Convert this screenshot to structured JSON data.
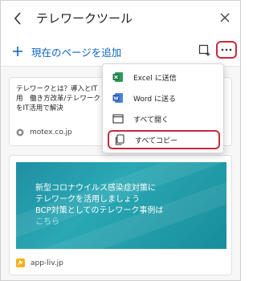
{
  "header": {
    "title": "テレワークツール"
  },
  "toolbar": {
    "add_page_label": "現在のページを追加"
  },
  "menu": {
    "items": [
      {
        "label": "Excel に送信",
        "icon": "excel-icon"
      },
      {
        "label": "Word に送る",
        "icon": "word-icon"
      },
      {
        "label": "すべて開く",
        "icon": "open-window-icon"
      },
      {
        "label": "すべてコピー",
        "icon": "copy-icon"
      }
    ]
  },
  "cards": [
    {
      "title_lines": [
        "テレワークとは？導入とIT",
        "用　働き方改革/テレワーク",
        "をIT活用で解決"
      ],
      "site": "motex.co.jp"
    },
    {
      "image_lines": [
        "新型コロナウイルス感染症対策に",
        "テレワークを活用しましょう",
        "BCP対策としてのテレワーク事例は",
        "こちら"
      ],
      "site": "app-liv.jp"
    }
  ],
  "colors": {
    "accent_blue": "#0a64c2",
    "highlight_red": "#c62b3a",
    "excel_green": "#1f7a45",
    "word_blue": "#2b5eb8",
    "teal": "#1f8fa3"
  }
}
